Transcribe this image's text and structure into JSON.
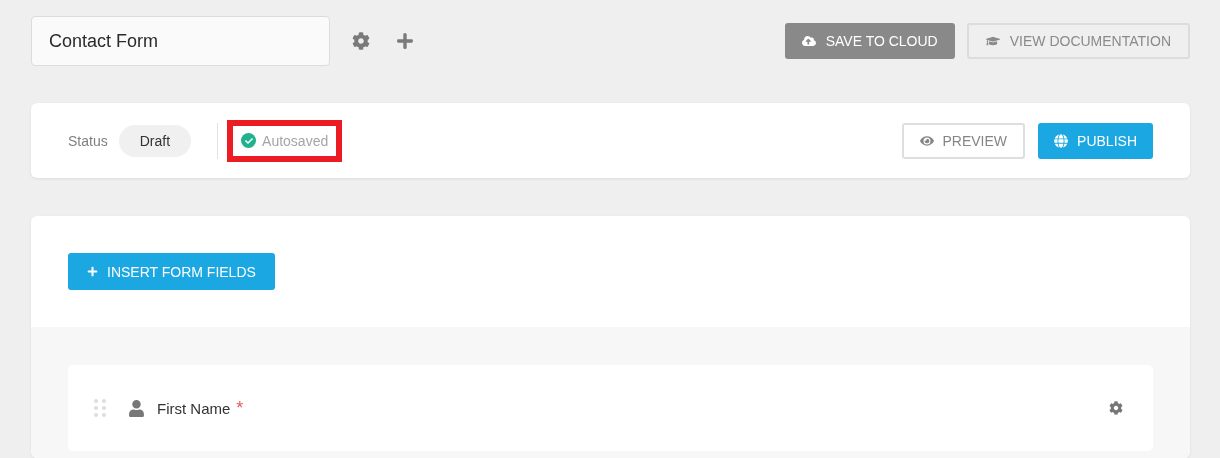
{
  "form_title": {
    "value": "Contact Form"
  },
  "toolbar": {
    "save_button": "SAVE TO CLOUD",
    "docs_button": "VIEW DOCUMENTATION"
  },
  "status_bar": {
    "label": "Status",
    "status": "Draft",
    "autosave": {
      "text": "Autosaved",
      "saved": true,
      "highlighted": true
    },
    "preview_button": "PREVIEW",
    "publish_button": "PUBLISH"
  },
  "insert_button": "INSERT FORM FIELDS",
  "fields": [
    {
      "label": "First Name",
      "required": true,
      "required_mark": "*",
      "kind": "person"
    }
  ]
}
